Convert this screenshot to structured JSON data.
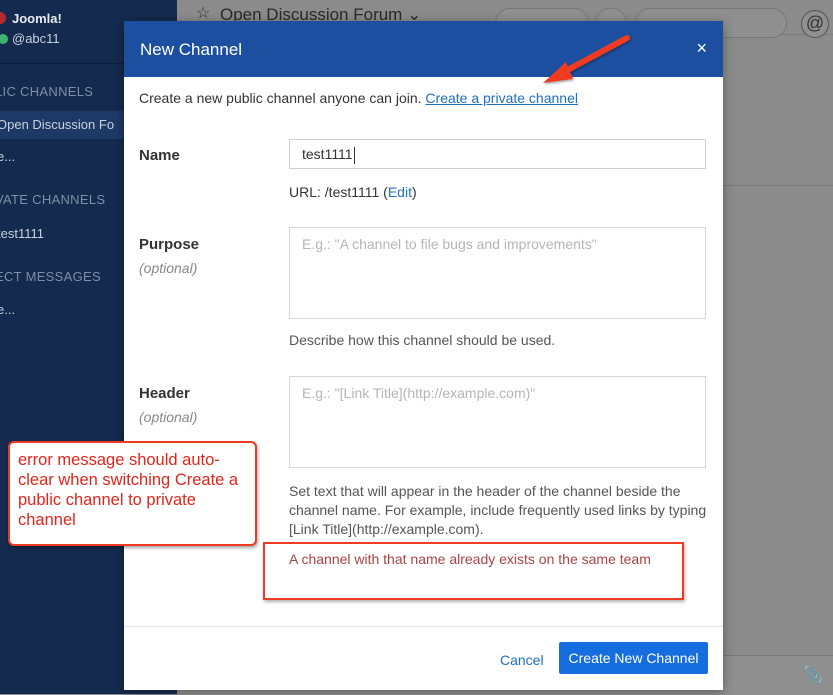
{
  "sidebar": {
    "team_name": "Joomla!",
    "username": "@abc11",
    "headings": [
      "LIC CHANNELS",
      "VATE CHANNELS",
      "ECT MESSAGES"
    ],
    "public_items": [
      "Open Discussion Fo",
      "e..."
    ],
    "private_items": [
      "test1111"
    ],
    "dm_items": [
      "e..."
    ]
  },
  "topbar": {
    "channel_title": "Open Discussion Forum",
    "at_icon": "@"
  },
  "modal": {
    "title": "New Channel",
    "close": "×",
    "intro_text": "Create a new public channel anyone can join.",
    "private_link": "Create a private channel",
    "name_label": "Name",
    "name_value": "test1111",
    "url_prefix": "URL: /test1111 (",
    "url_edit": "Edit",
    "url_suffix": ")",
    "purpose_label": "Purpose",
    "optional": "(optional)",
    "purpose_placeholder": "E.g.: \"A channel to file bugs and improvements\"",
    "purpose_help": "Describe how this channel should be used.",
    "header_label": "Header",
    "header_placeholder": "E.g.: \"[Link Title](http://example.com)\"",
    "header_help": "Set text that will appear in the header of the channel beside the channel name. For example, include frequently used links by typing [Link Title](http://example.com).",
    "error": "A channel with that name already exists on the same team",
    "cancel": "Cancel",
    "create": "Create New Channel"
  },
  "annotation": {
    "note": "error message should auto-clear when switching Create a public channel to private channel",
    "color": "#e1251b"
  }
}
